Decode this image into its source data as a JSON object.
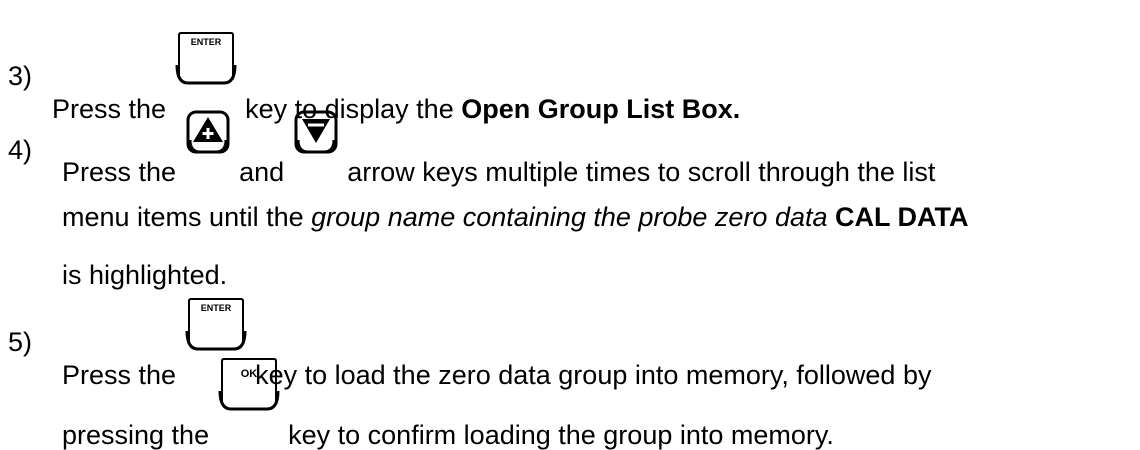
{
  "steps": [
    {
      "number": "3)",
      "before": "Press the",
      "key": "ENTER",
      "after": "key to display the",
      "bold": "Open Group List Box."
    },
    {
      "number": "4)",
      "before": "Press the",
      "and": "and",
      "after": "arrow keys multiple times to scroll through the list",
      "line2_plain": "menu items until the",
      "line2_italic": "group name containing the probe zero data",
      "line2_bold": "CAL DATA",
      "line3": "is highlighted."
    },
    {
      "number": "5)",
      "before": "Press the",
      "key": "ENTER",
      "after": "key to load the zero data group into memory, followed by",
      "line2_before": "pressing the",
      "line2_key": "OK",
      "line2_after": "key to confirm loading the group into memory."
    }
  ],
  "icons": {
    "up_arrow": "up-arrow-plus-key-icon",
    "down_arrow": "down-arrow-key-icon"
  }
}
